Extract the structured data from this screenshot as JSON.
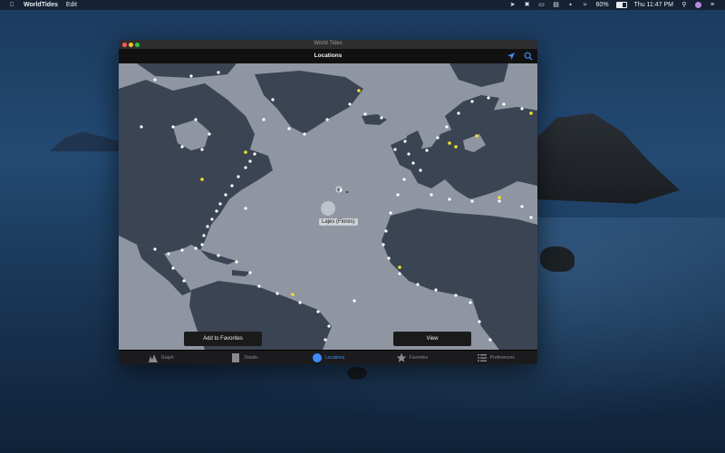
{
  "menubar": {
    "app_name": "WorldTides",
    "menu_edit": "Edit",
    "battery_percent": "60%",
    "clock": "Thu 11:47 PM",
    "battery_level": 0.6,
    "icons": [
      "apple-icon",
      "location-arrow-icon",
      "circle-x-icon",
      "airplay-icon",
      "window-icon",
      "bluetooth-icon",
      "wifi-icon",
      "battery-icon",
      "spotlight-icon",
      "user-icon",
      "control-center-icon"
    ]
  },
  "window": {
    "title": "World Tides",
    "nav_title": "Locations",
    "location_label": "Lajes (Flores)"
  },
  "buttons": {
    "add_favorites": "Add to Favorites",
    "view": "View"
  },
  "tabs": [
    {
      "label": "Graph",
      "icon": "graph-icon",
      "active": false
    },
    {
      "label": "Details",
      "icon": "details-icon",
      "active": false
    },
    {
      "label": "Locations",
      "icon": "globe-icon",
      "active": true
    },
    {
      "label": "Favorites",
      "icon": "star-icon",
      "active": false
    },
    {
      "label": "Preferences",
      "icon": "list-icon",
      "active": false
    }
  ],
  "colors": {
    "accent": "#3d8bfd",
    "ocean": "#8f96a2",
    "land": "#3b4452",
    "station": "#ffffff",
    "station_highlight": "#f2e22a"
  }
}
